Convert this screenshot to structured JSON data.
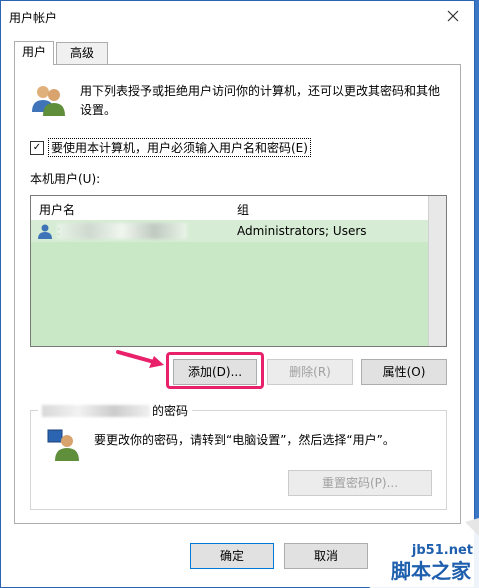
{
  "window": {
    "title": "用户帐户"
  },
  "tabs": [
    {
      "label": "用户"
    },
    {
      "label": "高级"
    }
  ],
  "description": "用下列表授予或拒绝用户访问你的计算机，还可以更改其密码和其他设置。",
  "require_login": {
    "label": "要使用本计算机，用户必须输入用户名和密码(E)",
    "checked": true,
    "mark": "✓"
  },
  "local_users": {
    "label": "本机用户(U):",
    "columns": [
      "用户名",
      "组"
    ],
    "rows": [
      {
        "username": ":",
        "group": "Administrators; Users"
      }
    ]
  },
  "buttons": {
    "add": "添加(D)...",
    "remove": "删除(R)",
    "properties": "属性(O)",
    "reset_password": "重置密码(P)...",
    "ok": "确定",
    "cancel": "取消"
  },
  "password_group": {
    "title": "的密码",
    "text": "要更改你的密码，请转到“电脑设置”，然后选择“用户”。"
  },
  "watermark": {
    "url": "jb51.net",
    "text": "脚本之家"
  },
  "colors": {
    "list_bg": "#c8e8c6",
    "highlight": "#e8216a",
    "accent": "#2b64b0"
  }
}
